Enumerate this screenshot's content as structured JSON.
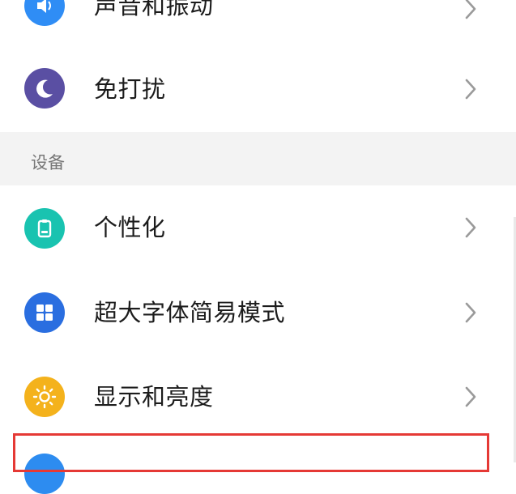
{
  "items_top": [
    {
      "label": "声音和振动",
      "icon": "speaker-icon",
      "color": "#2f8df5"
    },
    {
      "label": "免打扰",
      "icon": "moon-icon",
      "color": "#5a4fa3"
    }
  ],
  "section": {
    "title": "设备"
  },
  "items_device": [
    {
      "label": "个性化",
      "icon": "phone-theme-icon",
      "color": "#19c3b0"
    },
    {
      "label": "超大字体简易模式",
      "icon": "grid-icon",
      "color": "#2a6ee0"
    },
    {
      "label": "显示和亮度",
      "icon": "sun-icon",
      "color": "#f4b21c"
    }
  ],
  "accent_colors": {
    "highlight_border": "#e53935",
    "section_bg": "#f3f3f3"
  }
}
